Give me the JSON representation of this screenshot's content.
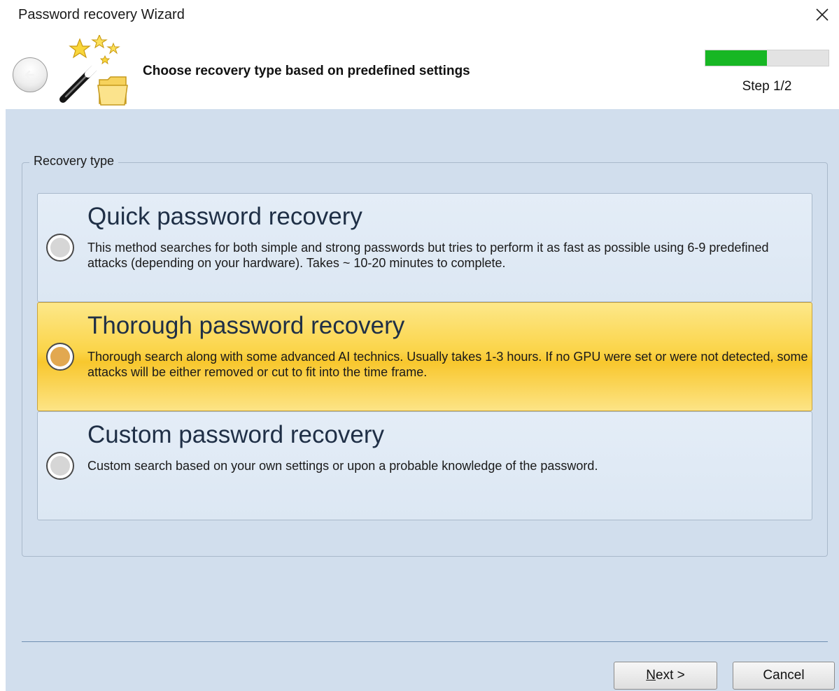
{
  "window": {
    "title": "Password recovery Wizard",
    "close_icon": "close-icon"
  },
  "header": {
    "back_icon": "back-arrow-icon",
    "wizard_icon": "magic-wand-icon",
    "title": "Choose recovery type based on predefined settings",
    "step_label": "Step 1/2",
    "progress": 0.5,
    "progress_color": "#17b724"
  },
  "group": {
    "legend": "Recovery type"
  },
  "options": [
    {
      "title": "Quick password recovery",
      "description": "This method searches for both simple and strong passwords but tries to perform it as fast as possible using 6-9 predefined attacks (depending on your hardware). Takes ~ 10-20 minutes to complete.",
      "selected": false
    },
    {
      "title": "Thorough password recovery",
      "description": "Thorough search along with some advanced AI technics. Usually takes 1-3 hours. If no GPU were set or were not detected, some attacks will be either removed or cut to fit into the time frame.",
      "selected": true
    },
    {
      "title": "Custom password recovery",
      "description": "Custom search based on your own settings or upon a probable knowledge of the password.",
      "selected": false
    }
  ],
  "buttons": {
    "next_mnemonic": "N",
    "next_rest": "ext >",
    "cancel": "Cancel"
  },
  "colors": {
    "body_background": "#d1deed",
    "selected_option": "#f8c72d"
  }
}
